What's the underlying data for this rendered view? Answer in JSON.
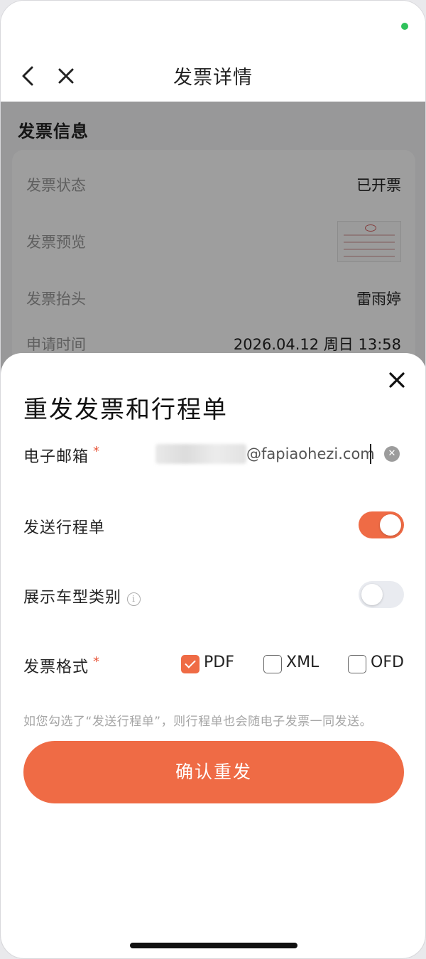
{
  "nav": {
    "title": "发票详情"
  },
  "page": {
    "section_title": "发票信息",
    "rows": [
      {
        "label": "发票状态",
        "value": "已开票"
      },
      {
        "label": "发票预览",
        "value": ""
      },
      {
        "label": "发票抬头",
        "value": "雷雨婷"
      },
      {
        "label": "申请时间",
        "value": "2026.04.12 周日 13:58"
      }
    ]
  },
  "sheet": {
    "title": "重发发票和行程单",
    "email": {
      "label": "电子邮箱",
      "required": "*",
      "value_visible": "@fapiaohezi.com"
    },
    "send_itinerary": {
      "label": "发送行程单",
      "enabled": true
    },
    "show_car_type": {
      "label": "展示车型类别",
      "enabled": false
    },
    "format": {
      "label": "发票格式",
      "required": "*",
      "options": [
        {
          "label": "PDF",
          "checked": true
        },
        {
          "label": "XML",
          "checked": false
        },
        {
          "label": "OFD",
          "checked": false
        }
      ]
    },
    "hint": "如您勾选了“发送行程单”，则行程单也会随电子发票一同发送。",
    "confirm_label": "确认重发"
  },
  "colors": {
    "accent": "#ef6b45",
    "status_dot": "#2fc25b",
    "required": "#e8553a"
  }
}
